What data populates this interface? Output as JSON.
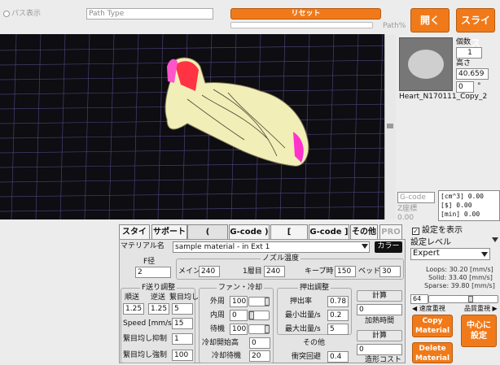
{
  "top": {
    "path_view": "パス表示",
    "path_type": "Path Type",
    "reset": "リセット",
    "path_pct": "Path%",
    "open": "開く",
    "slice": "スライス"
  },
  "model": {
    "name": "Heart_N170111_Copy_2",
    "count_label": "個数",
    "count": "1",
    "height_label": "高さ",
    "height": "40.659",
    "angle": "0",
    "deg": "°"
  },
  "gcode_sel": "G-code",
  "zcoord": "Z座標",
  "zval": "0.00",
  "stats": {
    "vol_unit": "[cm^3]",
    "vol": "0.00",
    "cost_unit": "[$]",
    "cost": "0.00",
    "time_unit": "[min]",
    "time": "0.00"
  },
  "tabs": [
    "スタイル",
    "サポート",
    "( Material",
    "G-code )",
    "[ Printer",
    "G-code ]",
    "その他",
    "PRO"
  ],
  "material": {
    "label": "マテリアル名",
    "value": "sample material - in Ext 1",
    "color_btn": "カラー",
    "f_dia_label": "F径",
    "f_dia": "2",
    "nozzle_title": "ノズル温度",
    "main_label": "メイン",
    "main": "240",
    "layer1_label": "1層目",
    "layer1": "240",
    "keep_label": "キープ時",
    "keep": "150",
    "bed_label": "ベッド",
    "bed": "30"
  },
  "feed": {
    "title": "F送り調整",
    "fwd_label": "順送",
    "rev_label": "逆送",
    "rev_long_label": "繋目均し",
    "fwd": "1.25",
    "rev": "1.25",
    "rev_long": "5",
    "speed_label": "Speed [mm/s]",
    "speed": "15",
    "suppress_label": "繋目均し抑制",
    "suppress": "1",
    "force_label": "繋目均し強制",
    "force": "100"
  },
  "fan": {
    "title": "ファン・冷却",
    "outer_label": "外周",
    "outer": "100",
    "inner_label": "内周",
    "inner": "0",
    "standby_label": "待機",
    "standby": "100",
    "start_h_label": "冷却開始高",
    "start_h": "0",
    "wait_label": "冷却待機",
    "wait": "20"
  },
  "extrude": {
    "title": "押出調整",
    "rate_label": "押出率",
    "rate": "0.78",
    "min_label": "最小出量/s",
    "min": "0.2",
    "max_label": "最大出量/s",
    "max": "5",
    "other_title": "その他",
    "avoid_label": "衝突回避",
    "avoid": "0.4"
  },
  "calc": {
    "btn1": "計算",
    "val1": "0",
    "heat_label": "加熱時間",
    "btn2": "計算",
    "val2": "0",
    "cost_label": "造形コスト"
  },
  "right": {
    "show_settings": "設定を表示",
    "level_label": "設定レベル",
    "level": "Expert",
    "loops": "Loops:  30.20 [mm/s]",
    "solid": "Solid:  33.40 [mm/s]",
    "sparse": "Sparse: 39.80 [mm/s]",
    "slider_val": "64",
    "speed_label": "◀ 速度重視",
    "quality_label": "品質重視 ▶",
    "copy": "Copy Material",
    "delete": "Delete Material",
    "center": "中心に 設定"
  },
  "colors": {
    "accent": "#f07a1a",
    "viewport": "#0d0d12",
    "grid": "#5a4a8a"
  }
}
